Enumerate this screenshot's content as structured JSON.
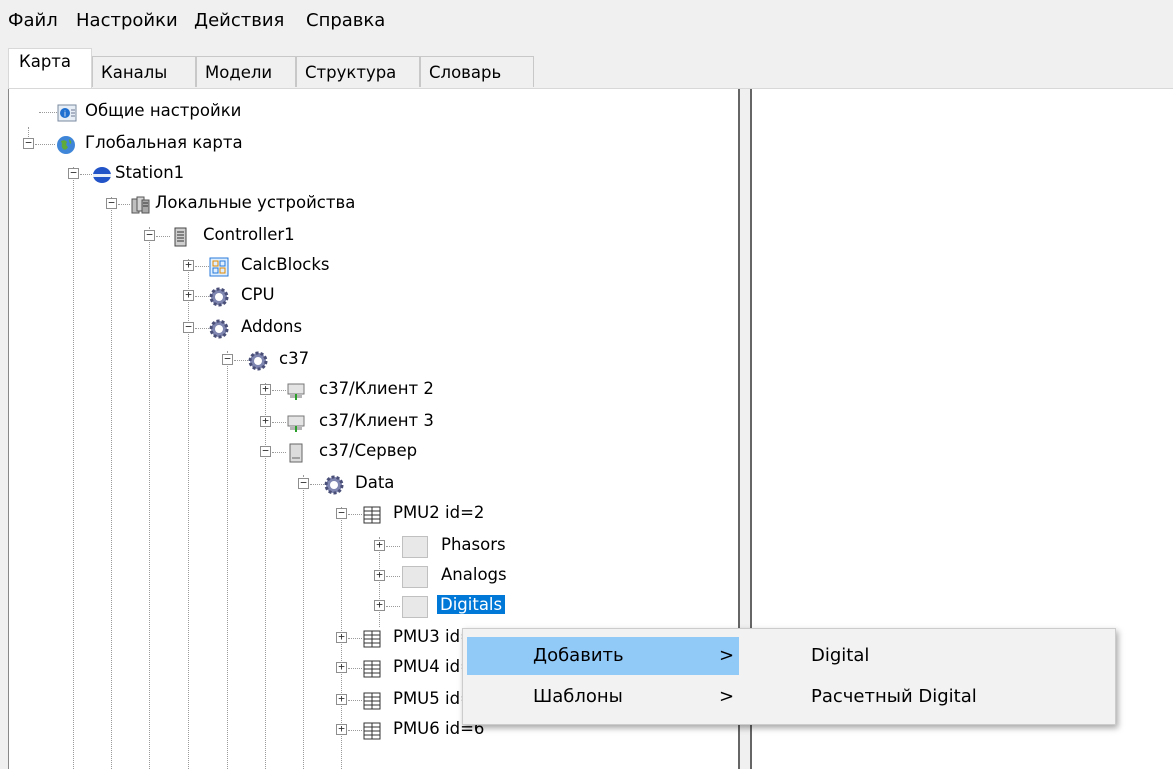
{
  "menubar": {
    "items": [
      "Файл",
      "Настройки",
      "Действия",
      "Справка"
    ]
  },
  "tabs": [
    "Карта",
    "Каналы",
    "Модели",
    "Структура",
    "Словарь"
  ],
  "tree": {
    "general_settings": "Общие настройки",
    "global_map": "Глобальная карта",
    "station": "Station1",
    "local_devices": "Локальные устройства",
    "controller": "Controller1",
    "calcblocks": "CalcBlocks",
    "cpu": "CPU",
    "addons": "Addons",
    "c37": "c37",
    "client2": "c37/Клиент 2",
    "client3": "c37/Клиент 3",
    "server": "c37/Сервер",
    "data": "Data",
    "pmu2": "PMU2 id=2",
    "phasors": "Phasors",
    "analogs": "Analogs",
    "digitals": "Digitals",
    "pmu3": "PMU3 id=3",
    "pmu4": "PMU4 id=4",
    "pmu5": "PMU5 id=5",
    "pmu6": "PMU6 id=6"
  },
  "context_menu": {
    "add": "Добавить",
    "templates": "Шаблоны",
    "arrow": ">"
  },
  "submenu": {
    "digital": "Digital",
    "calc_digital": "Расчетный Digital"
  }
}
